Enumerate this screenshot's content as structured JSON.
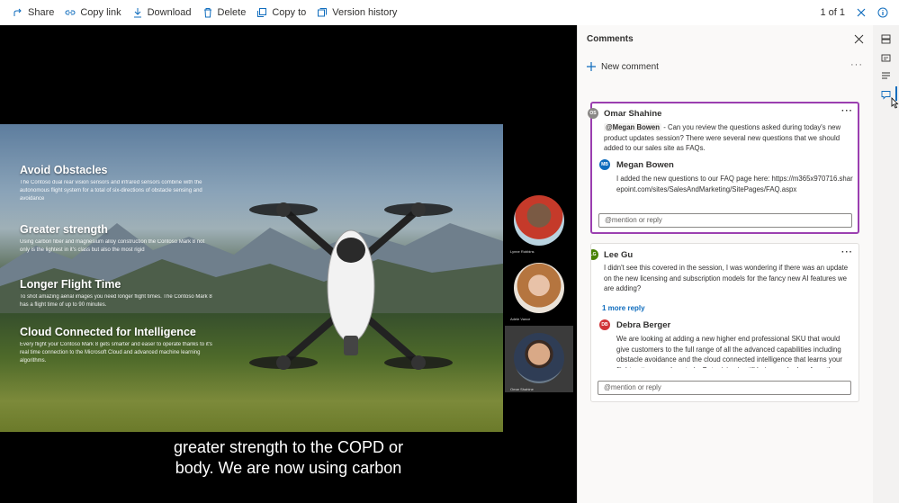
{
  "toolbar": {
    "share": "Share",
    "copy_link": "Copy link",
    "download": "Download",
    "delete": "Delete",
    "copy_to": "Copy to",
    "version_history": "Version history",
    "pager": "1 of 1"
  },
  "slide": {
    "features": [
      {
        "title": "Avoid Obstacles",
        "body": "The Contoso dual rear vision sensors and infrared sensors combine with the autonomous flight system for a total of six-directions of obstacle sensing and avoidance"
      },
      {
        "title": "Greater strength",
        "body": "Using carbon fiber and magnesium alloy construction the Contoso Mark 8 not only is the lightest in it's class but also the most rigid"
      },
      {
        "title": "Longer Flight Time",
        "body": "To shot amazing aerial images you need longer flight times. The Contoso Mark 8 has a flight time of up to 90 minutes."
      },
      {
        "title": "Cloud Connected for Intelligence",
        "body": "Every flight your Contoso Mark 8 gets smarter and easer to operate thanks to it's real time connection to the Microsoft Cloud and advanced machine learning algorithms."
      }
    ]
  },
  "participants": [
    {
      "name": "Lynne Robbins"
    },
    {
      "name": "Adele Vance"
    },
    {
      "name": "Omar Shahine"
    }
  ],
  "caption": {
    "line1": "greater strength to the COPD or",
    "line2": "body. We are now using carbon"
  },
  "comments_panel": {
    "title": "Comments",
    "new_comment": "New comment",
    "more": "···",
    "reply_placeholder": "@mention or reply",
    "threads": [
      {
        "author": "Omar Shahine",
        "initials": "OS",
        "mention": "@Megan Bowen",
        "text": " - Can you review the questions asked during today's new product updates session? There were several new questions that we should added to our sales site as FAQs.",
        "reply": {
          "author": "Megan Bowen",
          "initials": "MB",
          "text": "I added the new questions to our FAQ page here: https://m365x970716.sharepoint.com/sites/SalesAndMarketing/SitePages/FAQ.aspx"
        }
      },
      {
        "author": "Lee Gu",
        "initials": "LG",
        "text": "I didn't see this covered in the session, I was wondering if there was an update on the new licensing and subscription models for the fancy new AI features we are adding?",
        "more_replies": "1 more reply",
        "reply": {
          "author": "Debra Berger",
          "initials": "DB",
          "text": "We are looking at adding a new higher end professional SKU that would give customers to the full range of all the advanced capabilities including obstacle avoidance and the cloud connected intelligence that learns your flight patterns and controls. But pricing is still being worked on from the"
        }
      }
    ]
  },
  "colors": {
    "accent": "#0f6cbd",
    "selected_border": "#9b3fb0",
    "os_avatar": "#8a8886",
    "mb_avatar": "#0f6cbd",
    "lg_avatar": "#498205",
    "db_avatar": "#d13438"
  }
}
